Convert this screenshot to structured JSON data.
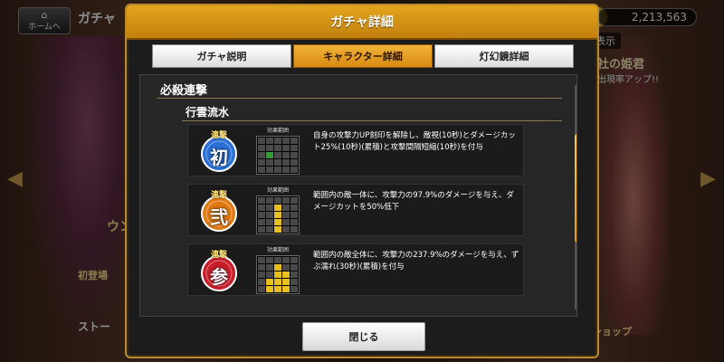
{
  "background": {
    "home_label": "ホームへ",
    "title": "ガチャ",
    "currency": "2,213,563",
    "display_label": "表示",
    "event_banner": "社の姫君",
    "event_sub": "出現率アップ!!",
    "char_name": "ウン",
    "char_sub": "初登場",
    "story_label": "ストー",
    "shop_label": "ショップ"
  },
  "dialog": {
    "title": "ガチャ詳細",
    "tabs": [
      {
        "label": "ガチャ説明",
        "active": false
      },
      {
        "label": "キャラクター詳細",
        "active": true
      },
      {
        "label": "灯幻鏡詳細",
        "active": false
      }
    ],
    "section_title": "必殺連撃",
    "sub_title": "行雲流水",
    "grid_label": "効果範囲",
    "skills": [
      {
        "badge_top": "連撃",
        "badge_char": "初",
        "badge_color": "#2a70d8",
        "description": "自身の攻撃力UP刻印を解除し、敵視(10秒)とダメージカット25%(10秒)(累積)と攻撃間隔短縮(10秒)を付与",
        "grid": [
          [
            0,
            0,
            0,
            0,
            0
          ],
          [
            0,
            0,
            0,
            0,
            0
          ],
          [
            0,
            2,
            0,
            0,
            0
          ],
          [
            0,
            0,
            0,
            0,
            0
          ],
          [
            0,
            0,
            0,
            0,
            0
          ]
        ]
      },
      {
        "badge_top": "連撃",
        "badge_char": "弐",
        "badge_color": "#e07a12",
        "description": "範囲内の敵一体に、攻撃力の97.9%のダメージを与え、ダメージカットを50%低下",
        "grid": [
          [
            0,
            0,
            0,
            0,
            0
          ],
          [
            0,
            0,
            1,
            0,
            0
          ],
          [
            0,
            0,
            1,
            0,
            0
          ],
          [
            0,
            0,
            1,
            0,
            0
          ],
          [
            0,
            0,
            1,
            0,
            0
          ]
        ]
      },
      {
        "badge_top": "連撃",
        "badge_char": "参",
        "badge_color": "#c81e2a",
        "description": "範囲内の敵全体に、攻撃力の237.9%のダメージを与え、ずぶ濡れ(30秒)(累積)を付与",
        "grid": [
          [
            0,
            0,
            0,
            0,
            0
          ],
          [
            0,
            0,
            1,
            0,
            0
          ],
          [
            0,
            0,
            1,
            1,
            0
          ],
          [
            0,
            1,
            1,
            1,
            0
          ],
          [
            0,
            1,
            1,
            1,
            0
          ]
        ]
      }
    ],
    "close_label": "閉じる"
  },
  "colors": {
    "header": "#d8931a",
    "active_tab": "#e5a024",
    "grid_on": "#e8c020",
    "grid_self": "#3a9a3a"
  }
}
